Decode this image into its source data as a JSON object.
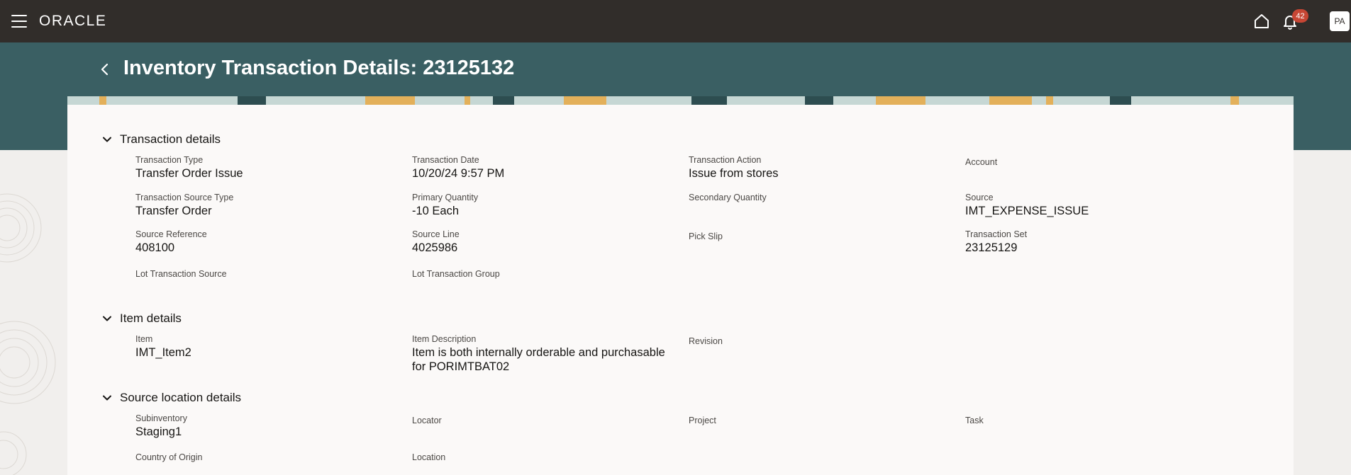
{
  "topbar": {
    "logo": "ORACLE",
    "notification_count": "42",
    "avatar_initials": "PA"
  },
  "page": {
    "title": "Inventory Transaction Details: 23125132"
  },
  "sections": {
    "transaction": {
      "title": "Transaction details",
      "fields": {
        "transaction_type": {
          "label": "Transaction Type",
          "value": "Transfer Order Issue"
        },
        "transaction_date": {
          "label": "Transaction Date",
          "value": "10/20/24 9:57 PM"
        },
        "transaction_action": {
          "label": "Transaction Action",
          "value": "Issue from stores"
        },
        "account": {
          "label": "Account",
          "value": ""
        },
        "transaction_source_type": {
          "label": "Transaction Source Type",
          "value": "Transfer Order"
        },
        "primary_quantity": {
          "label": "Primary Quantity",
          "value": "-10 Each"
        },
        "secondary_quantity": {
          "label": "Secondary Quantity",
          "value": ""
        },
        "source": {
          "label": "Source",
          "value": "IMT_EXPENSE_ISSUE"
        },
        "source_reference": {
          "label": "Source Reference",
          "value": "408100"
        },
        "source_line": {
          "label": "Source Line",
          "value": "4025986"
        },
        "pick_slip": {
          "label": "Pick Slip",
          "value": ""
        },
        "transaction_set": {
          "label": "Transaction Set",
          "value": "23125129"
        },
        "lot_transaction_source": {
          "label": "Lot Transaction Source",
          "value": ""
        },
        "lot_transaction_group": {
          "label": "Lot Transaction Group",
          "value": ""
        }
      }
    },
    "item": {
      "title": "Item details",
      "fields": {
        "item": {
          "label": "Item",
          "value": "IMT_Item2"
        },
        "item_description": {
          "label": "Item Description",
          "value": "Item is both internally orderable and purchasable for PORIMTBAT02"
        },
        "revision": {
          "label": "Revision",
          "value": ""
        }
      }
    },
    "source_location": {
      "title": "Source location details",
      "fields": {
        "subinventory": {
          "label": "Subinventory",
          "value": "Staging1"
        },
        "locator": {
          "label": "Locator",
          "value": ""
        },
        "project": {
          "label": "Project",
          "value": ""
        },
        "task": {
          "label": "Task",
          "value": ""
        },
        "country_of_origin": {
          "label": "Country of Origin",
          "value": ""
        },
        "location": {
          "label": "Location",
          "value": ""
        }
      }
    }
  }
}
